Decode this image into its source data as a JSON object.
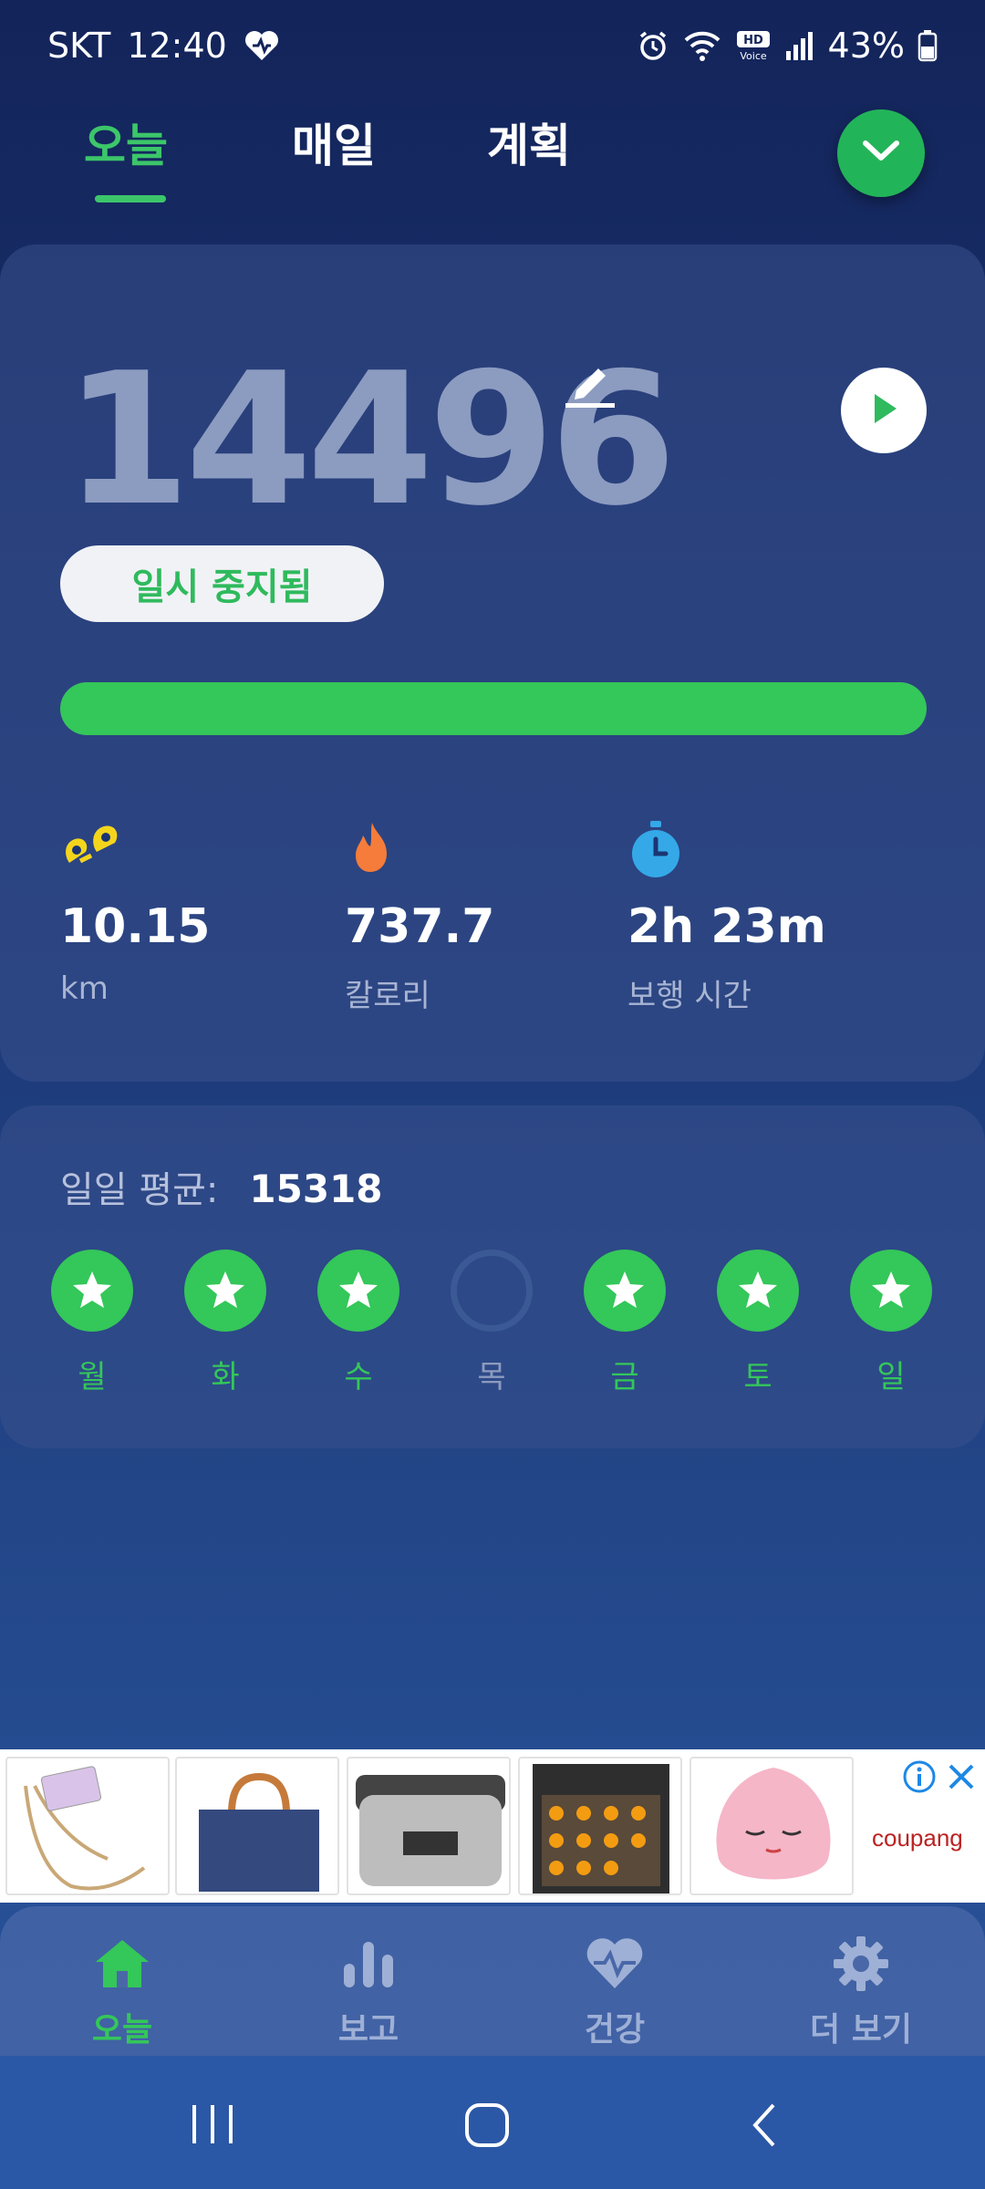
{
  "status_bar": {
    "carrier": "SKT",
    "time": "12:40",
    "battery": "43%"
  },
  "tabs": [
    {
      "label": "오늘",
      "active": true
    },
    {
      "label": "매일",
      "active": false
    },
    {
      "label": "계획",
      "active": false
    }
  ],
  "today": {
    "steps": "14496",
    "status_label": "일시 중지됨",
    "progress_fraction": 1.0,
    "stats": [
      {
        "icon": "distance-icon",
        "value": "10.15",
        "label": "km"
      },
      {
        "icon": "flame-icon",
        "value": "737.7",
        "label": "칼로리"
      },
      {
        "icon": "stopwatch-icon",
        "value": "2h 23m",
        "label": "보행 시간"
      }
    ]
  },
  "daily_average": {
    "label": "일일 평균:",
    "value": "15318",
    "days": [
      {
        "label": "월",
        "achieved": true
      },
      {
        "label": "화",
        "achieved": true
      },
      {
        "label": "수",
        "achieved": true
      },
      {
        "label": "목",
        "achieved": false
      },
      {
        "label": "금",
        "achieved": true
      },
      {
        "label": "토",
        "achieved": true
      },
      {
        "label": "일",
        "achieved": true
      }
    ]
  },
  "ad": {
    "brand": "coupang"
  },
  "bottom_nav": [
    {
      "label": "오늘",
      "icon": "home-icon",
      "active": true
    },
    {
      "label": "보고",
      "icon": "bar-chart-icon",
      "active": false
    },
    {
      "label": "건강",
      "icon": "heart-pulse-icon",
      "active": false
    },
    {
      "label": "더 보기",
      "icon": "gear-icon",
      "active": false
    }
  ],
  "colors": {
    "accent_green": "#34c759",
    "background": "#1b3572"
  }
}
